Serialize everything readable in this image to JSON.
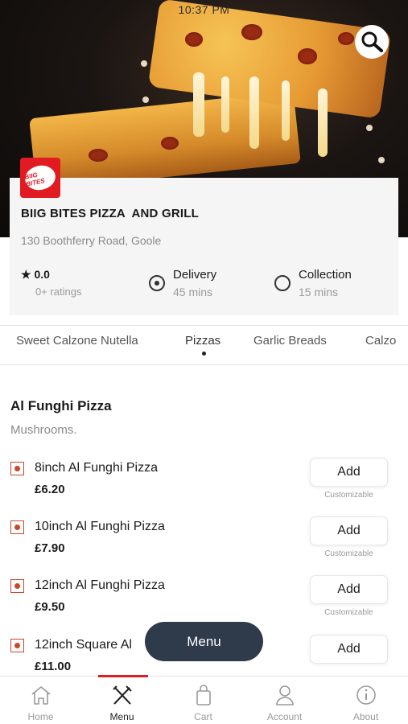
{
  "status_bar": {
    "time": "10:37 PM"
  },
  "hero": {
    "search_icon": "search-icon"
  },
  "store": {
    "logo_text": "BIIG BITES",
    "name": "BIIG BITES PIZZA  AND GRILL",
    "address": "130 Boothferry Road, Goole",
    "rating": "0.0",
    "rating_count": "0+ ratings",
    "options": [
      {
        "label": "Delivery",
        "time": "45 mins",
        "selected": true
      },
      {
        "label": "Collection",
        "time": "15 mins",
        "selected": false
      }
    ]
  },
  "category_tabs": [
    "Sweet Calzone Nutella",
    "Pizzas",
    "Garlic Breads",
    "Calzo"
  ],
  "active_tab": "Pizzas",
  "section": {
    "title": "Al Funghi Pizza",
    "description": "Mushrooms.",
    "items": [
      {
        "name": "8inch Al Funghi Pizza",
        "price": "£6.20",
        "button": "Add",
        "note": "Customizable"
      },
      {
        "name": "10inch Al Funghi Pizza",
        "price": "£7.90",
        "button": "Add",
        "note": "Customizable"
      },
      {
        "name": "12inch Al Funghi Pizza",
        "price": "£9.50",
        "button": "Add",
        "note": "Customizable"
      },
      {
        "name": "12inch Square Al",
        "price": "£11.00",
        "button": "Add",
        "note": ""
      }
    ]
  },
  "floating_menu": {
    "label": "Menu"
  },
  "bottom_nav": [
    {
      "label": "Home",
      "icon": "home-icon"
    },
    {
      "label": "Menu",
      "icon": "utensils-icon"
    },
    {
      "label": "Cart",
      "icon": "bag-icon"
    },
    {
      "label": "Account",
      "icon": "user-icon"
    },
    {
      "label": "About",
      "icon": "info-icon"
    }
  ],
  "colors": {
    "accent": "#e21b23",
    "floating_button": "#2f3a4b",
    "veg_marker": "#c8492a"
  }
}
